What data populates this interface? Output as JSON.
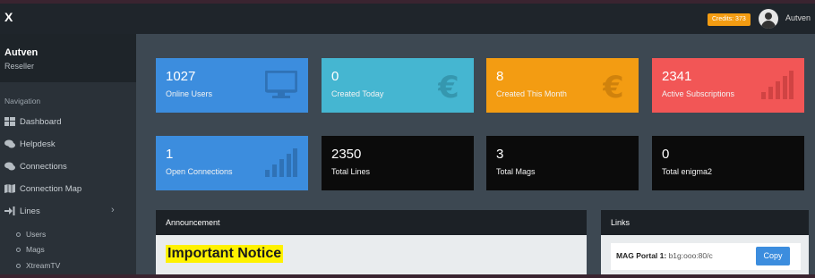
{
  "topbar": {
    "brand": "X",
    "credits": "Credits: 373",
    "user": "Autven"
  },
  "sidebar": {
    "profile_name": "Autven",
    "profile_role": "Reseller",
    "nav_heading": "Navigation",
    "items": [
      {
        "label": "Dashboard",
        "icon": "dashboard-icon"
      },
      {
        "label": "Helpdesk",
        "icon": "comments-icon"
      },
      {
        "label": "Connections",
        "icon": "comments-icon"
      },
      {
        "label": "Connection Map",
        "icon": "map-icon"
      },
      {
        "label": "Lines",
        "icon": "sign-in-icon"
      }
    ],
    "sub_items": [
      "Users",
      "Mags",
      "XtreamTV"
    ]
  },
  "stats": [
    {
      "value": "1027",
      "label": "Online Users",
      "color": "#3c8dde",
      "icon": "monitor-icon"
    },
    {
      "value": "0",
      "label": "Created Today",
      "color": "#45b6d1",
      "icon": "euro-icon"
    },
    {
      "value": "8",
      "label": "Created This Month",
      "color": "#f39c12",
      "icon": "euro-icon"
    },
    {
      "value": "2341",
      "label": "Active Subscriptions",
      "color": "#f25656",
      "icon": "signal-bars-icon"
    },
    {
      "value": "1",
      "label": "Open Connections",
      "color": "#3c8dde",
      "icon": "signal-bars-icon"
    },
    {
      "value": "2350",
      "label": "Total Lines",
      "color": "#0b0b0b"
    },
    {
      "value": "3",
      "label": "Total Mags",
      "color": "#0b0b0b"
    },
    {
      "value": "0",
      "label": "Total enigma2",
      "color": "#0b0b0b"
    }
  ],
  "announcement": {
    "title": "Announcement",
    "notice": "Important Notice"
  },
  "links": {
    "title": "Links",
    "row_label": "MAG Portal 1:",
    "row_value": "b1g:ooo:80/c",
    "copy_label": "Copy"
  }
}
